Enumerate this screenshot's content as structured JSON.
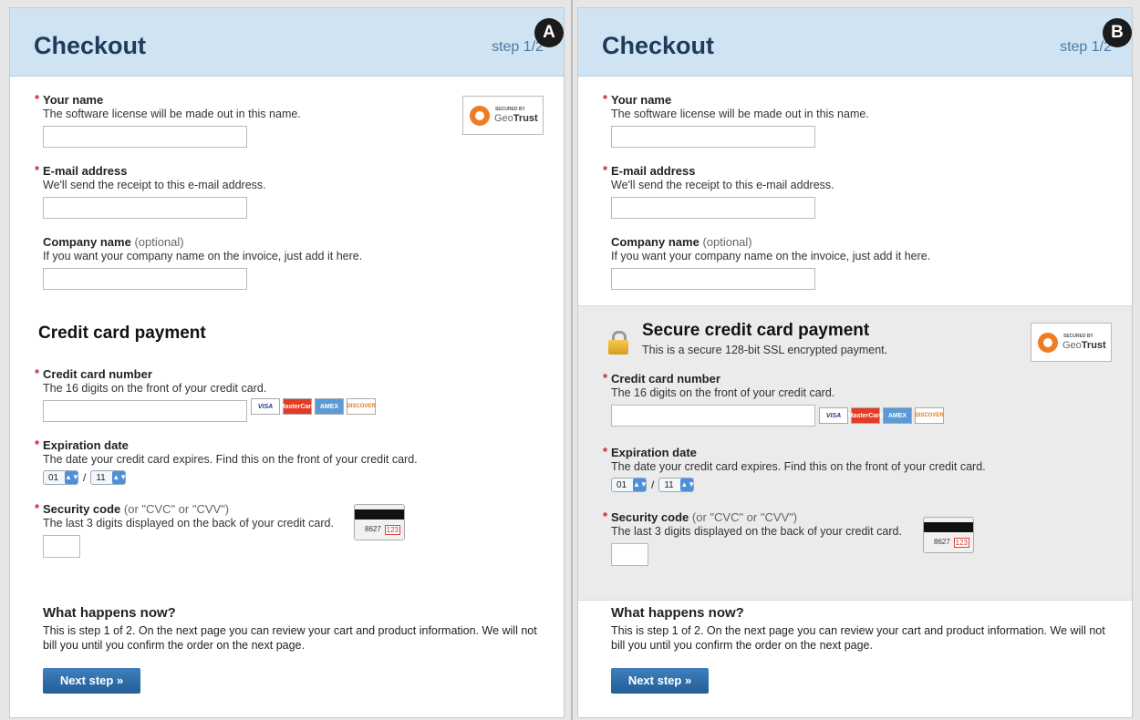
{
  "panels": {
    "a": {
      "badge": "A",
      "title": "Checkout",
      "step": "step 1/2",
      "geotrust": {
        "secured_by": "SECURED BY",
        "brand_a": "Geo",
        "brand_b": "Trust"
      },
      "your_name": {
        "label": "Your name",
        "help": "The software license will be made out in this name."
      },
      "email": {
        "label": "E-mail address",
        "help": "We'll send the receipt to this e-mail address."
      },
      "company": {
        "label": "Company name",
        "optional": "(optional)",
        "help": "If you want your company name on the invoice, just add it here."
      },
      "payment_title": "Credit card payment",
      "card_number": {
        "label": "Credit card number",
        "help": "The 16 digits on the front of your credit card."
      },
      "expiration": {
        "label": "Expiration date",
        "help": "The date your credit card expires. Find this on the front of your credit card.",
        "month": "01",
        "year": "11",
        "separator": "/"
      },
      "security": {
        "label": "Security code",
        "optional": "(or \"CVC\" or \"CVV\")",
        "help": "The last 3 digits displayed on the back of your credit card.",
        "card_digits": "8627",
        "code": "123"
      },
      "cards": {
        "visa": "VISA",
        "mastercard": "MasterCard",
        "amex": "AMEX",
        "discover": "DISCOVER"
      },
      "what_title": "What happens now?",
      "what_text": "This is step 1 of 2. On the next page you can review your cart and product information. We will not bill you until you confirm the order on the next page.",
      "next_button": "Next step »"
    },
    "b": {
      "badge": "B",
      "title": "Checkout",
      "step": "step 1/2",
      "geotrust": {
        "secured_by": "SECURED BY",
        "brand_a": "Geo",
        "brand_b": "Trust"
      },
      "your_name": {
        "label": "Your name",
        "help": "The software license will be made out in this name."
      },
      "email": {
        "label": "E-mail address",
        "help": "We'll send the receipt to this e-mail address."
      },
      "company": {
        "label": "Company name",
        "optional": "(optional)",
        "help": "If you want your company name on the invoice, just add it here."
      },
      "payment_title": "Secure credit card payment",
      "payment_subtitle": "This is a secure 128-bit SSL encrypted payment.",
      "card_number": {
        "label": "Credit card number",
        "help": "The 16 digits on the front of your credit card."
      },
      "expiration": {
        "label": "Expiration date",
        "help": "The date your credit card expires. Find this on the front of your credit card.",
        "month": "01",
        "year": "11",
        "separator": "/"
      },
      "security": {
        "label": "Security code",
        "optional": "(or \"CVC\" or \"CVV\")",
        "help": "The last 3 digits displayed on the back of your credit card.",
        "card_digits": "8627",
        "code": "123"
      },
      "cards": {
        "visa": "VISA",
        "mastercard": "MasterCard",
        "amex": "AMEX",
        "discover": "DISCOVER"
      },
      "what_title": "What happens now?",
      "what_text": "This is step 1 of 2. On the next page you can review your cart and product information. We will not bill you until you confirm the order on the next page.",
      "next_button": "Next step »"
    }
  },
  "required_marker": "*"
}
